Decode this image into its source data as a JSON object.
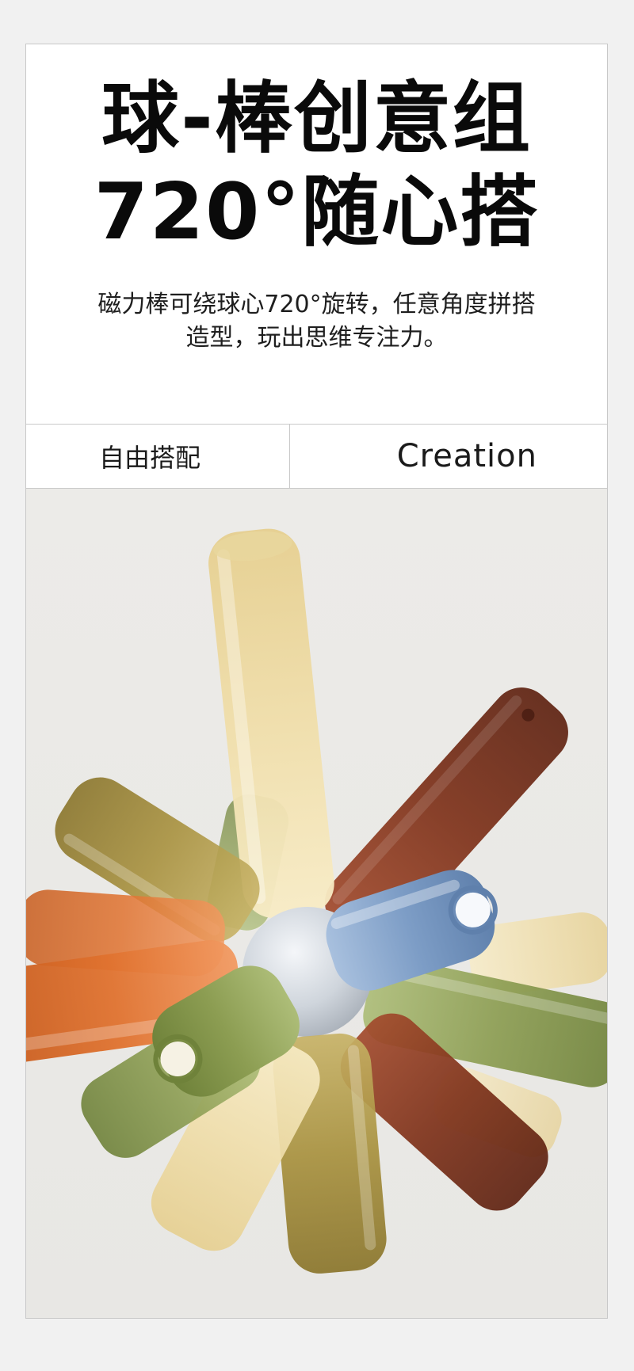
{
  "hero": {
    "title_line1": "球-棒创意组",
    "title_line2": "720°随心搭",
    "desc_line1": "磁力棒可绕球心720°旋转，任意角度拼搭",
    "desc_line2": "造型，玩出思维专注力。"
  },
  "split": {
    "left_label": "自由搭配",
    "right_label": "Creation"
  },
  "photo": {
    "icon": "magnetic-rods-ball-image",
    "colors": {
      "clear_yellow": "#f3e3ae",
      "brown": "#8a3a22",
      "olive": "#a89340",
      "orange": "#e2763a",
      "green": "#8e9f55",
      "blue": "#7f9fc8",
      "silver": "#d8dde4",
      "background": "#ebeae7"
    }
  }
}
